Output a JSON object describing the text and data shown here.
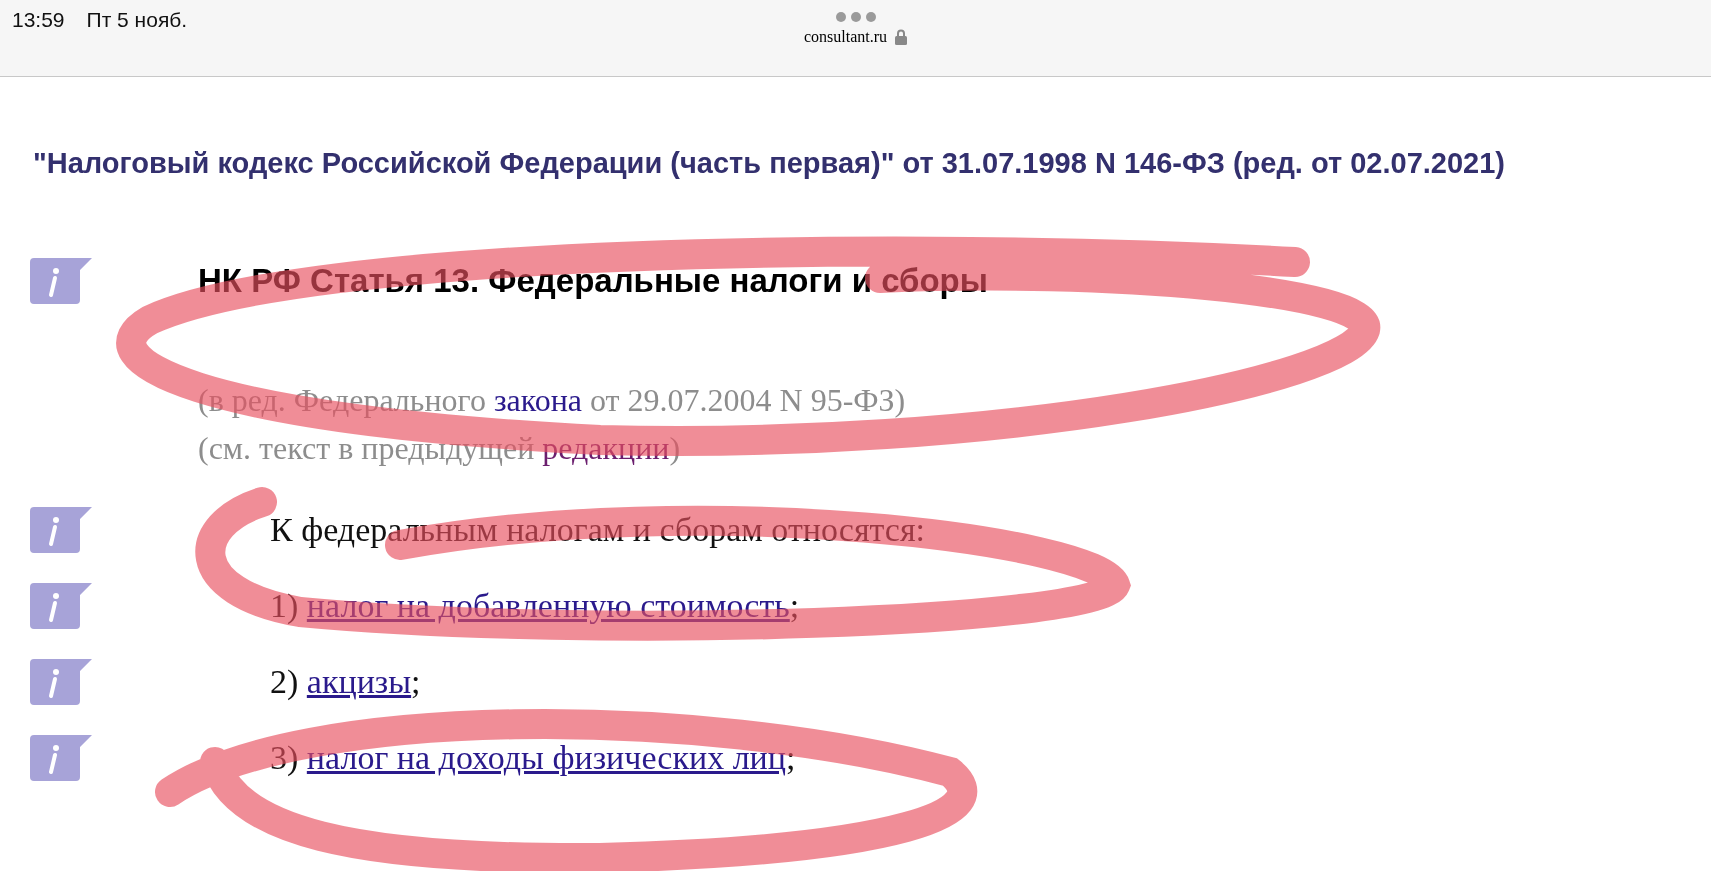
{
  "status_bar": {
    "time": "13:59",
    "date": "Пт 5 нояб.",
    "url": "consultant.ru"
  },
  "document_title": "\"Налоговый кодекс Российской Федерации (часть первая)\" от 31.07.1998 N 146-ФЗ (ред. от 02.07.2021)",
  "article_heading": "НК РФ Статья 13. Федеральные налоги и сборы",
  "notes": [
    {
      "before": "(в ред. Федерального ",
      "link": "закона",
      "after": " от 29.07.2004 N 95-ФЗ)"
    },
    {
      "before": "(см. текст в предыдущей ",
      "link": "редакции",
      "after": ")"
    }
  ],
  "intro": "К федеральным налогам и сборам относятся:",
  "items": [
    {
      "number": "1)",
      "link": "налог на добавленную стоимость",
      "suffix": ";"
    },
    {
      "number": "2)",
      "link": "акцизы",
      "suffix": ";"
    },
    {
      "number": "3)",
      "link": "налог на доходы физических лиц",
      "suffix": ";"
    }
  ]
}
